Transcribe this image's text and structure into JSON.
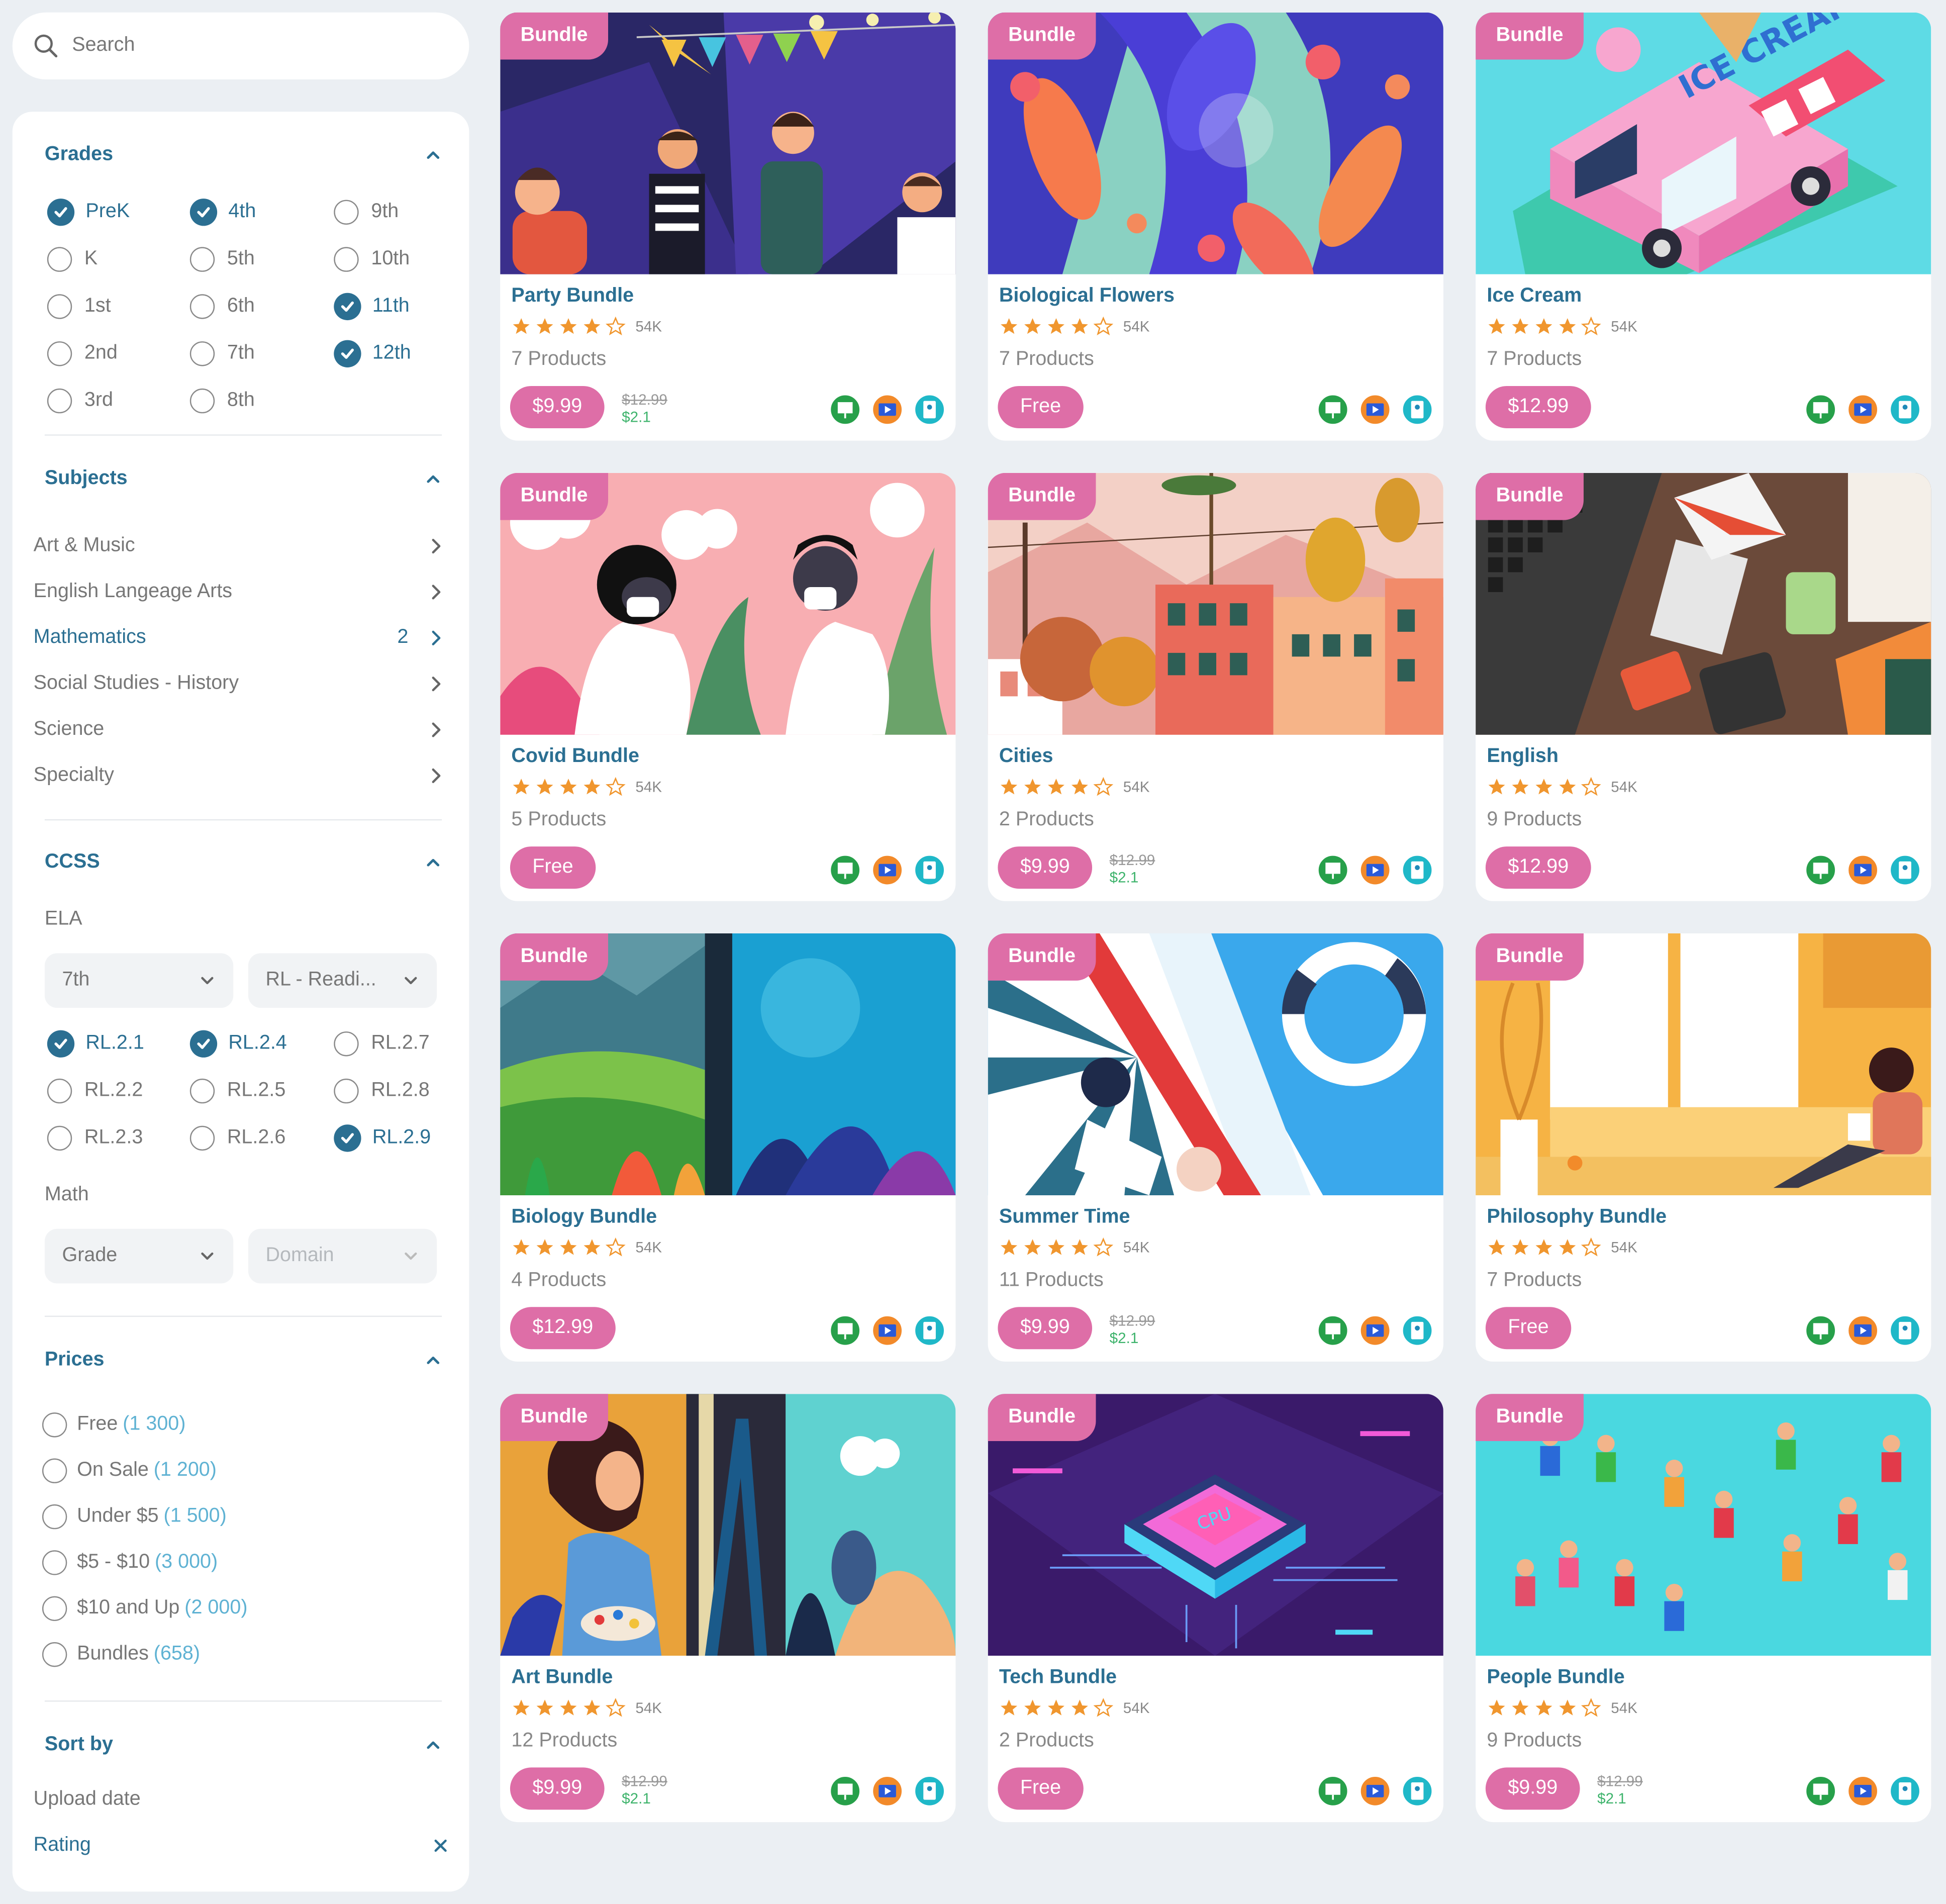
{
  "search": {
    "placeholder": "Search"
  },
  "filters": {
    "grades": {
      "title": "Grades",
      "options": [
        {
          "label": "PreK",
          "checked": true
        },
        {
          "label": "4th",
          "checked": true
        },
        {
          "label": "9th",
          "checked": false
        },
        {
          "label": "K",
          "checked": false
        },
        {
          "label": "5th",
          "checked": false
        },
        {
          "label": "10th",
          "checked": false
        },
        {
          "label": "1st",
          "checked": false
        },
        {
          "label": "6th",
          "checked": false
        },
        {
          "label": "11th",
          "checked": true
        },
        {
          "label": "2nd",
          "checked": false
        },
        {
          "label": "7th",
          "checked": false
        },
        {
          "label": "12th",
          "checked": true
        },
        {
          "label": "3rd",
          "checked": false
        },
        {
          "label": "8th",
          "checked": false
        }
      ]
    },
    "subjects": {
      "title": "Subjects",
      "items": [
        {
          "label": "Art & Music",
          "count": ""
        },
        {
          "label": "English Langeage Arts",
          "count": ""
        },
        {
          "label": "Mathematics",
          "count": "2",
          "active": true
        },
        {
          "label": "Social Studies - History",
          "count": ""
        },
        {
          "label": "Science",
          "count": ""
        },
        {
          "label": "Specialty",
          "count": ""
        }
      ]
    },
    "ccss": {
      "title": "CCSS",
      "ela_label": "ELA",
      "ela_grade": "7th",
      "ela_domain": "RL - Readi...",
      "standards": [
        {
          "label": "RL.2.1",
          "checked": true
        },
        {
          "label": "RL.2.4",
          "checked": true
        },
        {
          "label": "RL.2.7",
          "checked": false
        },
        {
          "label": "RL.2.2",
          "checked": false
        },
        {
          "label": "RL.2.5",
          "checked": false
        },
        {
          "label": "RL.2.8",
          "checked": false
        },
        {
          "label": "RL.2.3",
          "checked": false
        },
        {
          "label": "RL.2.6",
          "checked": false
        },
        {
          "label": "RL.2.9",
          "checked": true
        }
      ],
      "math_label": "Math",
      "math_grade": "Grade",
      "math_domain": "Domain"
    },
    "prices": {
      "title": "Prices",
      "options": [
        {
          "label": "Free",
          "count": "(1 300)"
        },
        {
          "label": "On Sale",
          "count": "(1 200)"
        },
        {
          "label": "Under $5",
          "count": "(1 500)"
        },
        {
          "label": "$5 - $10",
          "count": "(3 000)"
        },
        {
          "label": "$10 and Up",
          "count": "(2 000)"
        },
        {
          "label": "Bundles",
          "count": "(658)"
        }
      ]
    },
    "sort": {
      "title": "Sort by",
      "options": [
        {
          "label": "Upload date",
          "active": false
        },
        {
          "label": "Rating",
          "active": true
        }
      ],
      "clear_icon": "close-icon"
    }
  },
  "colors": {
    "accent": "#2b6f92",
    "pink": "#de6ea7",
    "sale": "#3db36b",
    "star": "#f0962e"
  },
  "cards": [
    {
      "badge": "Bundle",
      "title": "Party Bundle",
      "rating": 4,
      "reviews": "54K",
      "products": "7 Products",
      "price": "$9.99",
      "old": "$12.99",
      "new": "$2.1",
      "art": "party"
    },
    {
      "badge": "Bundle",
      "title": "Biological Flowers",
      "rating": 4,
      "reviews": "54K",
      "products": "7 Products",
      "price": "Free",
      "old": "",
      "new": "",
      "art": "flowers"
    },
    {
      "badge": "Bundle",
      "title": "Ice Cream",
      "rating": 4,
      "reviews": "54K",
      "products": "7 Products",
      "price": "$12.99",
      "old": "",
      "new": "",
      "art": "icecream"
    },
    {
      "badge": "Bundle",
      "title": "Covid Bundle",
      "rating": 4,
      "reviews": "54K",
      "products": "5 Products",
      "price": "Free",
      "old": "",
      "new": "",
      "art": "covid"
    },
    {
      "badge": "Bundle",
      "title": "Cities",
      "rating": 4,
      "reviews": "54K",
      "products": "2 Products",
      "price": "$9.99",
      "old": "$12.99",
      "new": "$2.1",
      "art": "cities"
    },
    {
      "badge": "Bundle",
      "title": "English",
      "rating": 4,
      "reviews": "54K",
      "products": "9 Products",
      "price": "$12.99",
      "old": "",
      "new": "",
      "art": "english"
    },
    {
      "badge": "Bundle",
      "title": "Biology Bundle",
      "rating": 4,
      "reviews": "54K",
      "products": "4 Products",
      "price": "$12.99",
      "old": "",
      "new": "",
      "art": "biology"
    },
    {
      "badge": "Bundle",
      "title": "Summer Time",
      "rating": 4,
      "reviews": "54K",
      "products": "11 Products",
      "price": "$9.99",
      "old": "$12.99",
      "new": "$2.1",
      "art": "summer"
    },
    {
      "badge": "Bundle",
      "title": "Philosophy Bundle",
      "rating": 4,
      "reviews": "54K",
      "products": "7 Products",
      "price": "Free",
      "old": "",
      "new": "",
      "art": "philosophy"
    },
    {
      "badge": "Bundle",
      "title": "Art Bundle",
      "rating": 4,
      "reviews": "54K",
      "products": "12 Products",
      "price": "$9.99",
      "old": "$12.99",
      "new": "$2.1",
      "art": "art"
    },
    {
      "badge": "Bundle",
      "title": "Tech Bundle",
      "rating": 4,
      "reviews": "54K",
      "products": "2 Products",
      "price": "Free",
      "old": "",
      "new": "",
      "art": "tech"
    },
    {
      "badge": "Bundle",
      "title": "People Bundle",
      "rating": 4,
      "reviews": "54K",
      "products": "9 Products",
      "price": "$9.99",
      "old": "$12.99",
      "new": "$2.1",
      "art": "people"
    }
  ],
  "card_icons": [
    "presentation-icon",
    "video-icon",
    "science-icon"
  ]
}
